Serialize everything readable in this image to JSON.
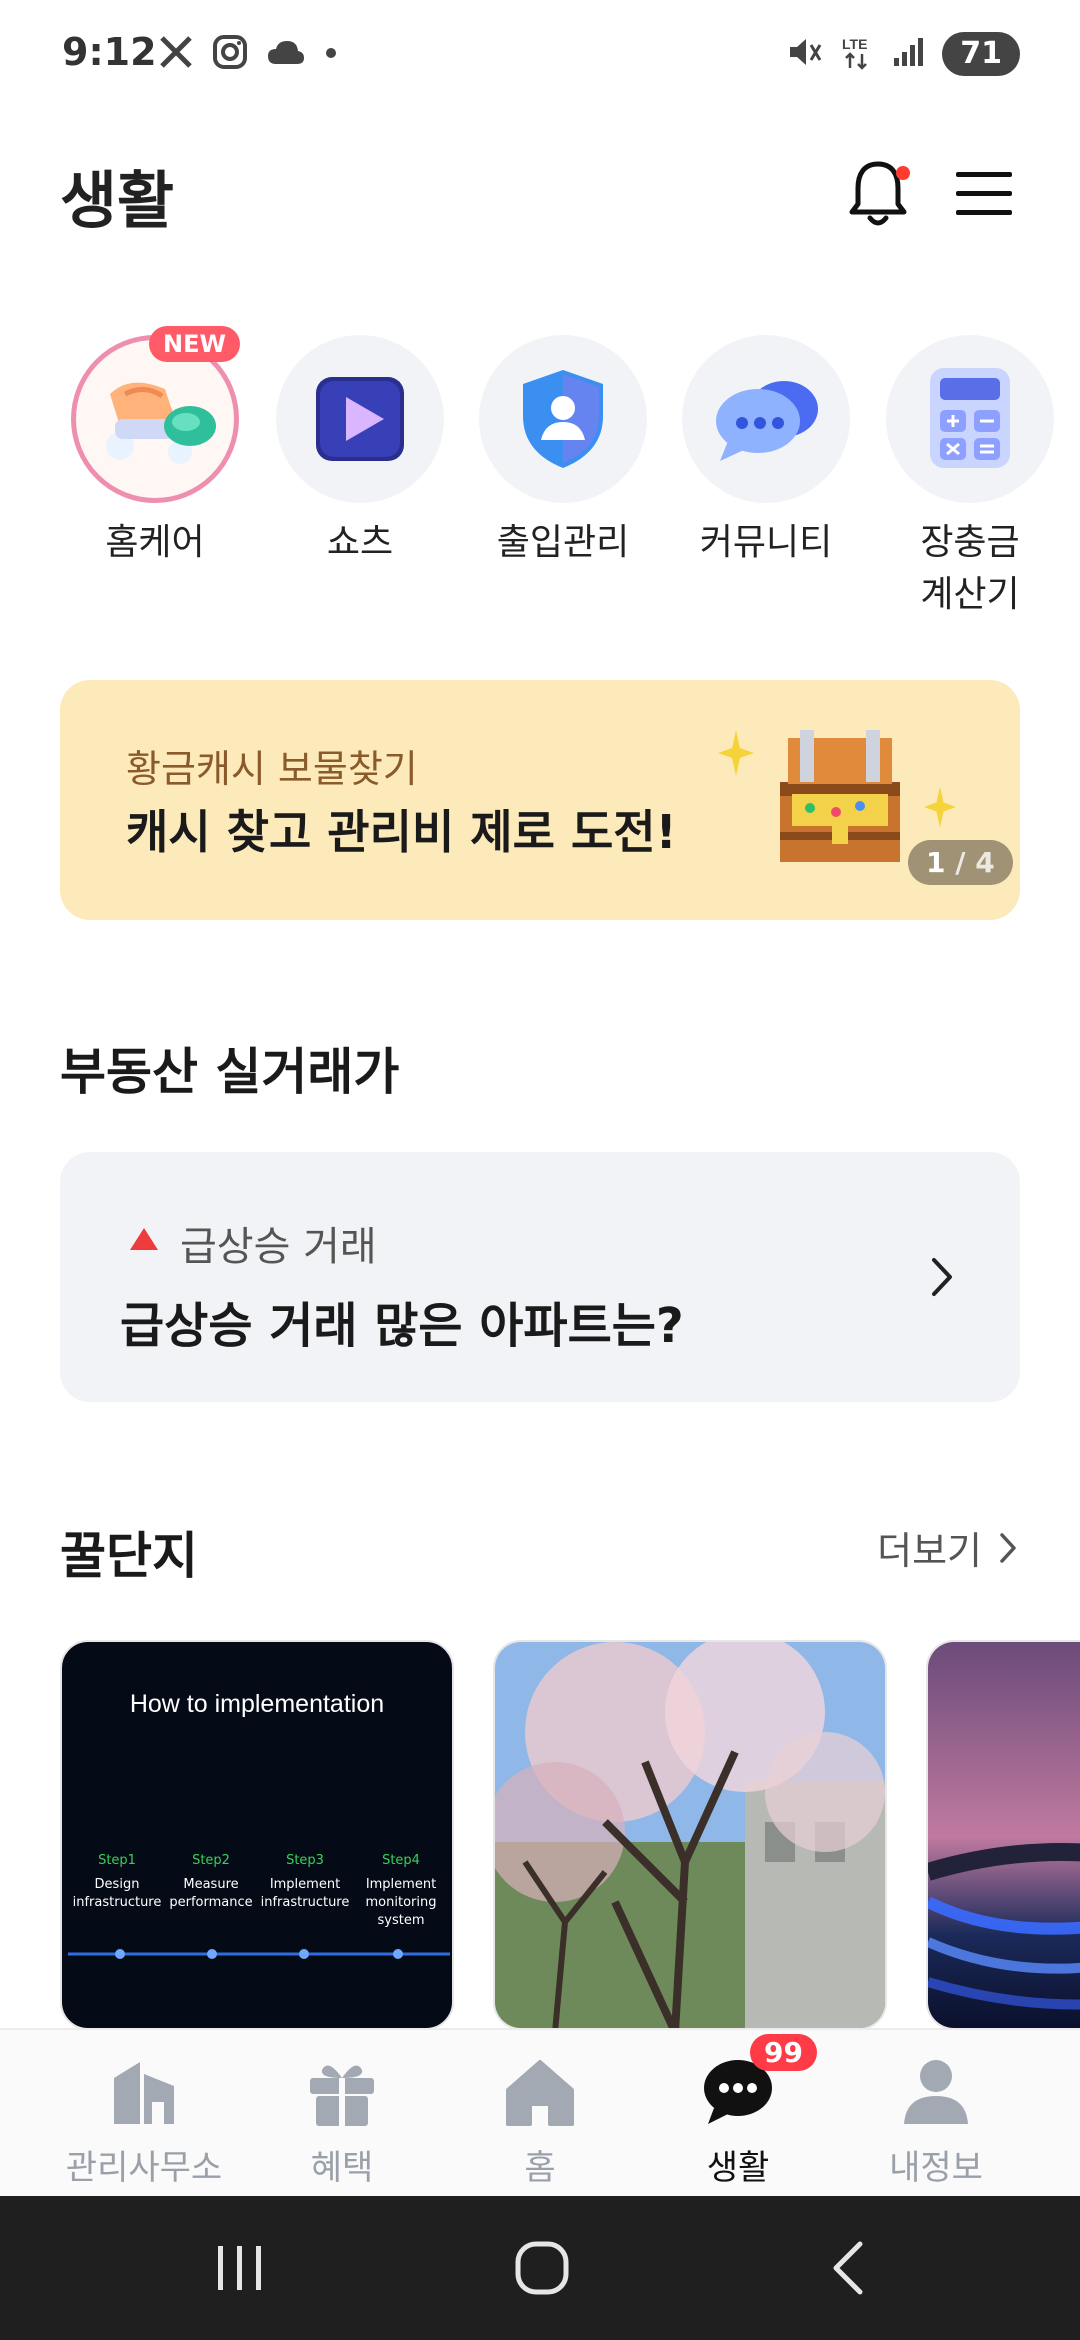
{
  "status_bar": {
    "time": "9:12",
    "battery": "71"
  },
  "header": {
    "title": "생활"
  },
  "quick_menu": [
    {
      "label": "홈케어",
      "badge": "NEW"
    },
    {
      "label": "쇼츠"
    },
    {
      "label": "출입관리"
    },
    {
      "label": "커뮤니티"
    },
    {
      "label_line1": "장충금",
      "label_line2": "계산기"
    }
  ],
  "banner": {
    "subtitle": "황금캐시 보물찾기",
    "title": "캐시 찾고 관리비 제로 도전!",
    "page_current": "1",
    "page_total": "4",
    "bg_color": "#fdeabb"
  },
  "real_estate": {
    "section_title": "부동산 실거래가",
    "tag": "급상승 거래",
    "title": "급상승 거래 많은 아파트는?"
  },
  "tips": {
    "section_title": "꿀단지",
    "more_label": "더보기",
    "card1": {
      "heading": "How to implementation",
      "steps": [
        {
          "step": "Step1",
          "text_line1": "Design",
          "text_line2": "infrastructure"
        },
        {
          "step": "Step2",
          "text_line1": "Measure",
          "text_line2": "performance"
        },
        {
          "step": "Step3",
          "text_line1": "Implement",
          "text_line2": "infrastructure"
        },
        {
          "step": "Step4",
          "text_line1": "Implement",
          "text_line2": "monitoring system"
        }
      ]
    }
  },
  "bottom_nav": [
    {
      "label": "관리사무소"
    },
    {
      "label": "혜택"
    },
    {
      "label": "홈"
    },
    {
      "label": "생활",
      "badge": "99",
      "active": true
    },
    {
      "label": "내정보"
    }
  ]
}
